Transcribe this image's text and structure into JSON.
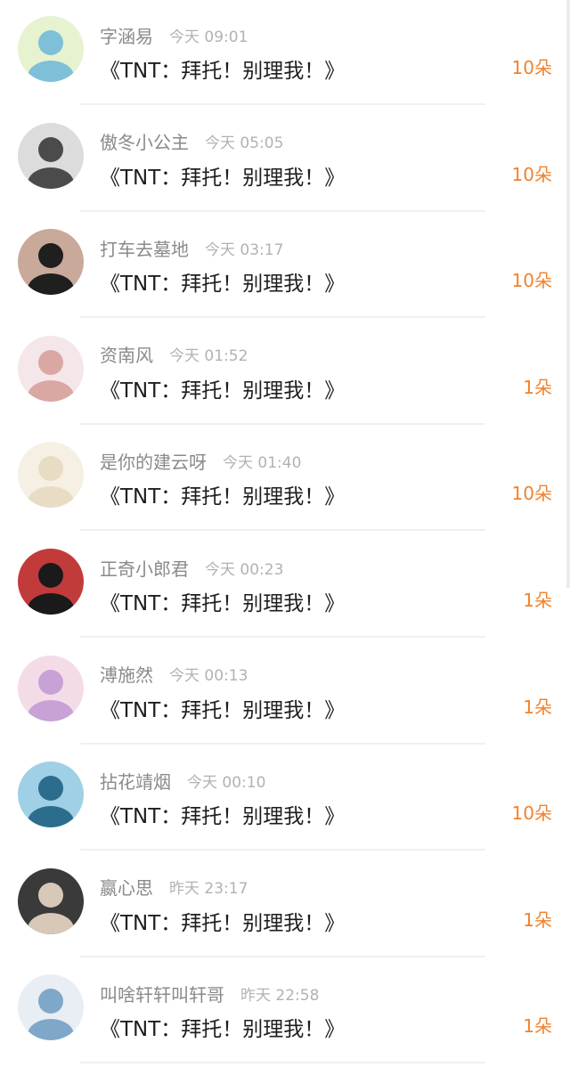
{
  "list": [
    {
      "name": "字涵易",
      "time": "今天 09:01",
      "title": "《TNT：拜托！别理我！》",
      "amount": "10朵",
      "avatar_icon": "avatar-image-icon",
      "avatar_colors": [
        "#7ec0d8",
        "#e7f2d1"
      ]
    },
    {
      "name": "傲冬小公主",
      "time": "今天 05:05",
      "title": "《TNT：拜托！别理我！》",
      "amount": "10朵",
      "avatar_icon": "avatar-image-icon",
      "avatar_colors": [
        "#4b4b4b",
        "#dcdcdc"
      ]
    },
    {
      "name": "打车去墓地",
      "time": "今天 03:17",
      "title": "《TNT：拜托！别理我！》",
      "amount": "10朵",
      "avatar_icon": "avatar-image-icon",
      "avatar_colors": [
        "#1f1f1f",
        "#c9a99a"
      ]
    },
    {
      "name": "资南风",
      "time": "今天 01:52",
      "title": "《TNT：拜托！别理我！》",
      "amount": "1朵",
      "avatar_icon": "avatar-image-icon",
      "avatar_colors": [
        "#d9a8a2",
        "#f5e6e9"
      ]
    },
    {
      "name": "是你的建云呀",
      "time": "今天 01:40",
      "title": "《TNT：拜托！别理我！》",
      "amount": "10朵",
      "avatar_icon": "avatar-image-icon",
      "avatar_colors": [
        "#e8dcc4",
        "#f6f0e4"
      ]
    },
    {
      "name": "正奇小郎君",
      "time": "今天 00:23",
      "title": "《TNT：拜托！别理我！》",
      "amount": "1朵",
      "avatar_icon": "avatar-image-icon",
      "avatar_colors": [
        "#1a1a1a",
        "#c23b3b"
      ]
    },
    {
      "name": "溥施然",
      "time": "今天 00:13",
      "title": "《TNT：拜托！别理我！》",
      "amount": "1朵",
      "avatar_icon": "avatar-image-icon",
      "avatar_colors": [
        "#c8a2d4",
        "#f3dce8"
      ]
    },
    {
      "name": "拈花靖烟",
      "time": "今天 00:10",
      "title": "《TNT：拜托！别理我！》",
      "amount": "10朵",
      "avatar_icon": "avatar-image-icon",
      "avatar_colors": [
        "#2c6c8c",
        "#9fd0e6"
      ]
    },
    {
      "name": "嬴心思",
      "time": "昨天 23:17",
      "title": "《TNT：拜托！别理我！》",
      "amount": "1朵",
      "avatar_icon": "avatar-image-icon",
      "avatar_colors": [
        "#d8c8b8",
        "#3a3a3a"
      ]
    },
    {
      "name": "叫啥轩轩叫轩哥",
      "time": "昨天 22:58",
      "title": "《TNT：拜托！别理我！》",
      "amount": "1朵",
      "avatar_icon": "avatar-image-icon",
      "avatar_colors": [
        "#7fa7c9",
        "#e8eef4"
      ]
    }
  ],
  "colors": {
    "name": "#8a8a8a",
    "time": "#b2b2b2",
    "title": "#1e1e1e",
    "amount": "#f0822d",
    "divider": "#f0f0f0"
  }
}
